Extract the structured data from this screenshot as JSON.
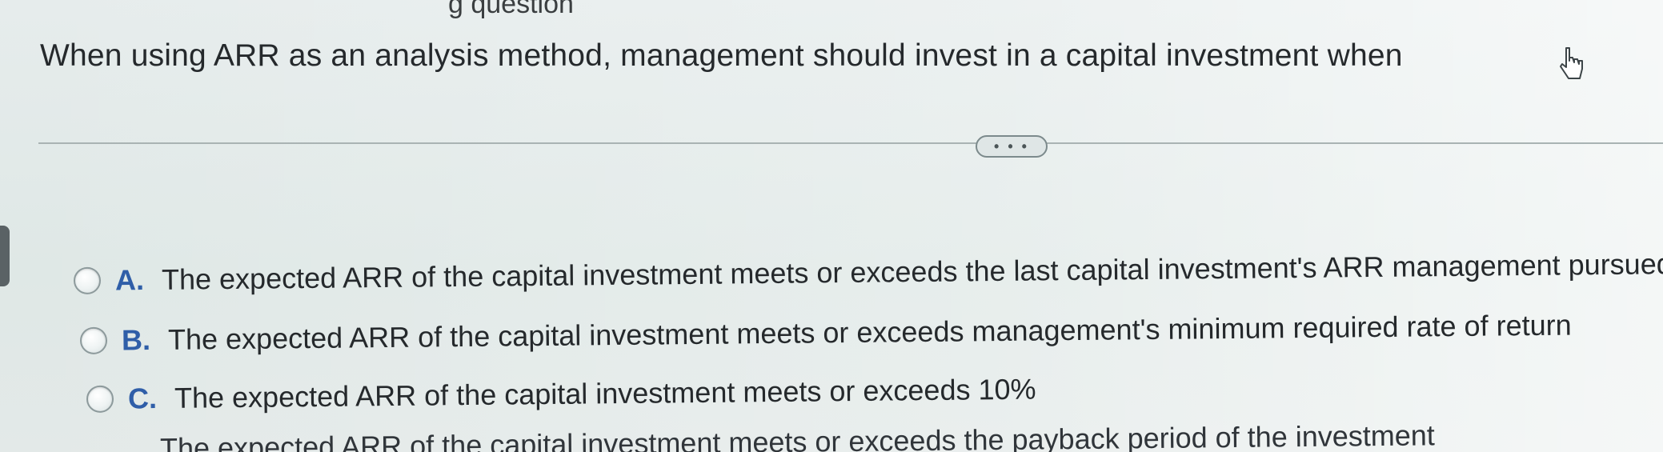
{
  "top_fragment": "g question",
  "question": {
    "text": "When using ARR as an analysis method, management should invest in a capital investment when"
  },
  "more_button": {
    "label": "• • •"
  },
  "options": [
    {
      "letter": "A.",
      "text": "The expected ARR of the capital investment meets or exceeds the last capital investment's ARR management pursued"
    },
    {
      "letter": "B.",
      "text": "The expected ARR of the capital investment meets or exceeds management's minimum required rate of return"
    },
    {
      "letter": "C.",
      "text": "The expected ARR of the capital investment meets or exceeds 10%"
    }
  ],
  "cut_off_option": {
    "text": "The expected ARR of the capital investment meets or exceeds the payback period of the investment"
  },
  "colors": {
    "option_letter": "#2f5ea8",
    "text": "#25292c",
    "background": "#e6ecec"
  },
  "icons": {
    "cursor": "hand-pointer-icon"
  }
}
